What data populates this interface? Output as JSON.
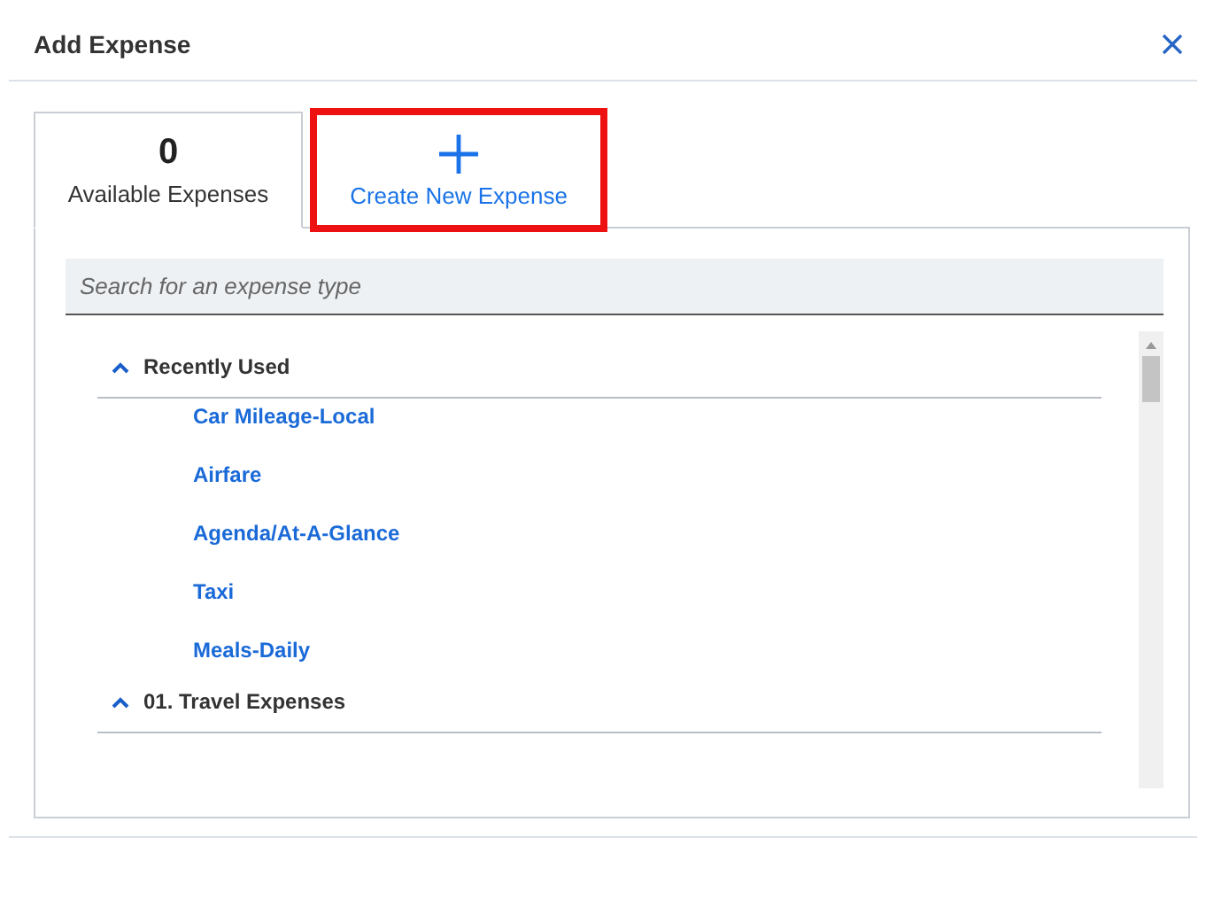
{
  "window": {
    "title": "Add Expense"
  },
  "tabs": [
    {
      "kind": "count",
      "count": "0",
      "label": "Available Expenses",
      "selected": true,
      "highlighted": false
    },
    {
      "kind": "create",
      "label": "Create New Expense",
      "selected": false,
      "highlighted": true
    }
  ],
  "search": {
    "placeholder": "Search for an expense type"
  },
  "groups": [
    {
      "label": "Recently Used",
      "expanded": true,
      "items": [
        "Car Mileage-Local",
        "Airfare",
        "Agenda/At-A-Glance",
        "Taxi",
        "Meals-Daily"
      ]
    },
    {
      "label": "01. Travel Expenses",
      "expanded": true
    }
  ]
}
